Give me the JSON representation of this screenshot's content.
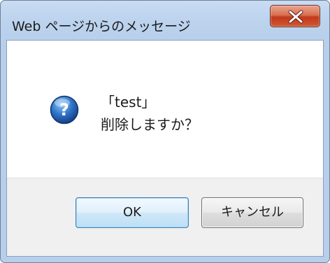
{
  "dialog": {
    "title": "Web ページからのメッセージ",
    "message_line1": "「test」",
    "message_line2": "削除しますか？",
    "icon": "question-icon",
    "buttons": {
      "ok_label": "OK",
      "cancel_label": "キャンセル"
    },
    "colors": {
      "titlebar": "#c8dcf2",
      "close_button": "#c2381c",
      "question_icon": "#1f5fb0",
      "ok_border": "#3c7fb1"
    }
  }
}
